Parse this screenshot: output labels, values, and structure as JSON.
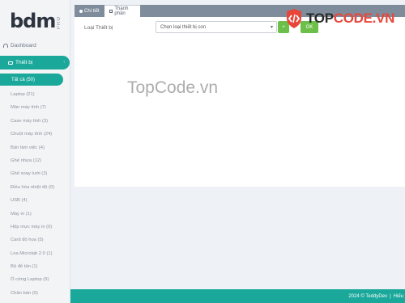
{
  "logo": {
    "text": "bdm",
    "sub": "PRO"
  },
  "sidebar": {
    "dashboard": "Dashboard",
    "device": "Thiết bị",
    "all": "Tất cả (50)",
    "items": [
      "Laptop (21)",
      "Màn máy tính (7)",
      "Case máy tính (3)",
      "Chuột máy tính (24)",
      "Bàn làm việc (4)",
      "Ghế nhựa (12)",
      "Ghế xoay lưới (3)",
      "Điều hòa nhiệt độ (0)",
      "USB (4)",
      "Máy in (1)",
      "Hộp mực máy in (0)",
      "Card đồ họa (5)",
      "Loa Microlab 2.0 (1)",
      "Bộ đế tản (1)",
      "Ổ cứng Laptop (9)",
      "Chân bàn (0)"
    ]
  },
  "tabs": {
    "detail": "Chi tiết",
    "component": "Thành phần"
  },
  "form": {
    "label": "Loại Thiết bị",
    "select_value": "Chọn loại thiết bị con",
    "add_label": "+",
    "ok_label": "OK"
  },
  "brand": {
    "part1": "TOP",
    "part2": "CODE.VN"
  },
  "watermark": "TopCode.vn",
  "footer": {
    "copyright": "2024 © TeddyDev",
    "sep": "|",
    "extra": "Hiếu"
  },
  "colors": {
    "accent": "#1aa89a",
    "tabbar": "#7f8c9b",
    "green": "#6cc04a",
    "brand_red": "#e8463b"
  }
}
